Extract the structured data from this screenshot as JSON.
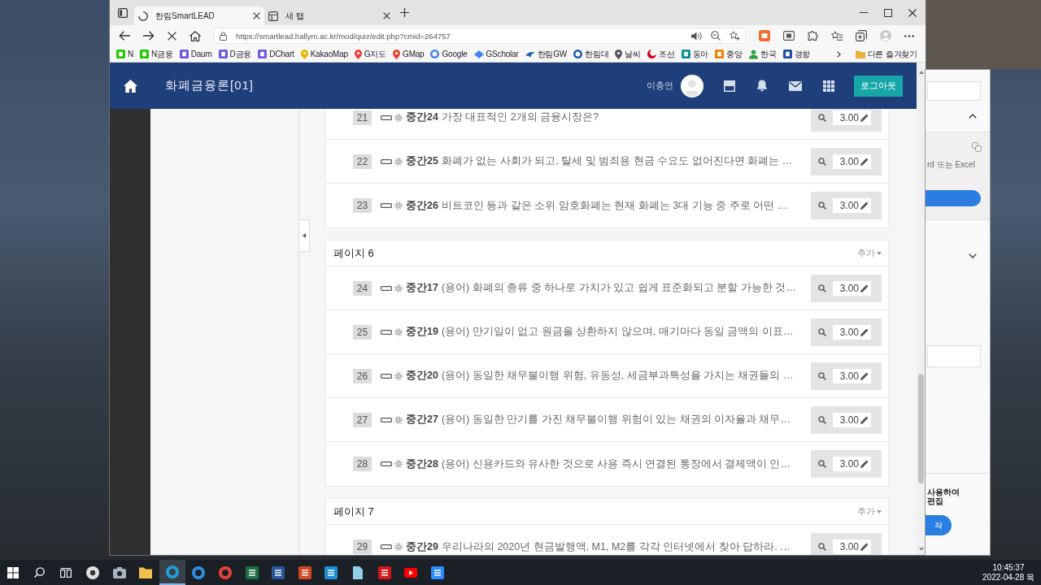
{
  "browser": {
    "tabs": [
      {
        "title": "한림SmartLEAD",
        "selected": true,
        "loading": true
      },
      {
        "title": "새 탭",
        "selected": false,
        "loading": false
      }
    ],
    "address_bar": {
      "url": "https://smartlead.hallym.ac.kr/mod/quiz/edit.php?cmid=264757"
    },
    "bookmarks": [
      {
        "label": "N",
        "kind": "tile",
        "color": "#1ec800"
      },
      {
        "label": "N금융",
        "kind": "tile",
        "color": "#1ec800"
      },
      {
        "label": "Daum",
        "kind": "tile",
        "color": "#6a5ae0"
      },
      {
        "label": "D금융",
        "kind": "tile",
        "color": "#6a5ae0"
      },
      {
        "label": "DChart",
        "kind": "tile",
        "color": "#6a5ae0"
      },
      {
        "label": "KakaoMap",
        "kind": "pin",
        "color": "#e8b400"
      },
      {
        "label": "G지도",
        "kind": "pin",
        "color": "#ea4335"
      },
      {
        "label": "GMap",
        "kind": "pin",
        "color": "#ea4335"
      },
      {
        "label": "Google",
        "kind": "ring",
        "color": "#4285f4"
      },
      {
        "label": "GScholar",
        "kind": "cap",
        "color": "#4285f4"
      },
      {
        "label": "한림GW",
        "kind": "wing",
        "color": "#1f5fa8"
      },
      {
        "label": "한림대",
        "kind": "ring",
        "color": "#1f5fa8"
      },
      {
        "label": "날씨",
        "kind": "pin",
        "color": "#555555"
      },
      {
        "label": "조선",
        "kind": "crescent",
        "color": "#d0021b"
      },
      {
        "label": "동아",
        "kind": "tile",
        "color": "#0f8f8f"
      },
      {
        "label": "중앙",
        "kind": "tile",
        "color": "#f08300"
      },
      {
        "label": "한국",
        "kind": "person",
        "color": "#2e9e3a"
      },
      {
        "label": "경향",
        "kind": "tile",
        "color": "#1f4fa0"
      }
    ],
    "other_bookmarks": "다른 즐겨찾기"
  },
  "page": {
    "header": {
      "course_title": "화폐금융론[01]",
      "user_name": "이충언",
      "logout_label": "로그아웃"
    },
    "sections": [
      {
        "rows": [
          {
            "number": "21",
            "name": "중간24",
            "text": "가장 대표적인 2개의 금융시장은?",
            "mark": "3.00"
          },
          {
            "number": "22",
            "name": "중간25",
            "text": "화폐가 없는 사회가 되고, 탈세 및 범죄용 현금 수요도 없어진다면 화폐는 …",
            "mark": "3.00"
          },
          {
            "number": "23",
            "name": "중간26",
            "text": "비트코인 등과 같은 소위 암호화폐는 현재 화폐는 3대 기능 중 주로 어떤 …",
            "mark": "3.00"
          }
        ]
      },
      {
        "heading": "페이지 6",
        "add_label": "추가",
        "rows": [
          {
            "number": "24",
            "name": "중간17",
            "text": "(용어) 화폐의 종류 중 하나로 가치가 있고 쉽게 표준화되고 분할 가능한 것…",
            "mark": "3.00"
          },
          {
            "number": "25",
            "name": "중간19",
            "text": "(용어) 만기일이 없고 원금을 상환하지 않으며, 매기마다 동일 금액의 이표…",
            "mark": "3.00"
          },
          {
            "number": "26",
            "name": "중간20",
            "text": "(용어) 동일한 채무불이행 위험, 유동성, 세금부과특성을 가지는 채권들의 …",
            "mark": "3.00"
          },
          {
            "number": "27",
            "name": "중간27",
            "text": "(용어) 동일한 만기를 가진 채무불이행 위험이 있는 채권의 이자율과 채무…",
            "mark": "3.00"
          },
          {
            "number": "28",
            "name": "중간28",
            "text": "(용어) 신용카드와 유사한 것으로 사용 즉시 연결된 통장에서 결제액이 인…",
            "mark": "3.00"
          }
        ]
      },
      {
        "heading": "페이지 7",
        "add_label": "추가",
        "rows": [
          {
            "number": "29",
            "name": "중간29",
            "text": "우리나라의 2020년 현금발행액, M1, M2를 각각 인터넷에서 찾아 답하라. …",
            "mark": "3.00"
          }
        ]
      }
    ]
  },
  "side_window": {
    "hint": "rd 또는 Excel",
    "caption": "사용하여 편집",
    "button_label": "작"
  },
  "taskbar": {
    "apps": [
      {
        "kind": "badge",
        "color": "#e0e0e0",
        "selected": false
      },
      {
        "kind": "camera",
        "color": "#a9b2bd",
        "selected": false
      },
      {
        "kind": "folder",
        "color": "#f2c14e",
        "selected": false
      },
      {
        "kind": "ring",
        "color": "#1f9fd8",
        "selected": true
      },
      {
        "kind": "ring",
        "color": "#2d8fe2",
        "selected": false
      },
      {
        "kind": "ring",
        "color": "#e94235",
        "selected": false
      },
      {
        "kind": "tile",
        "color": "#1d7044",
        "selected": false
      },
      {
        "kind": "tile",
        "color": "#2b579a",
        "selected": false
      },
      {
        "kind": "tile",
        "color": "#d24726",
        "selected": false
      },
      {
        "kind": "tile",
        "color": "#1c8ed6",
        "selected": false
      },
      {
        "kind": "page",
        "color": "#8fd0e8",
        "selected": false
      },
      {
        "kind": "tile",
        "color": "#d4161b",
        "selected": false
      },
      {
        "kind": "play",
        "color": "#ff0000",
        "selected": false
      },
      {
        "kind": "tile",
        "color": "#2d8cff",
        "selected": false
      }
    ],
    "clock": {
      "time": "10:45:37",
      "date": "2022-04-28 목"
    }
  }
}
